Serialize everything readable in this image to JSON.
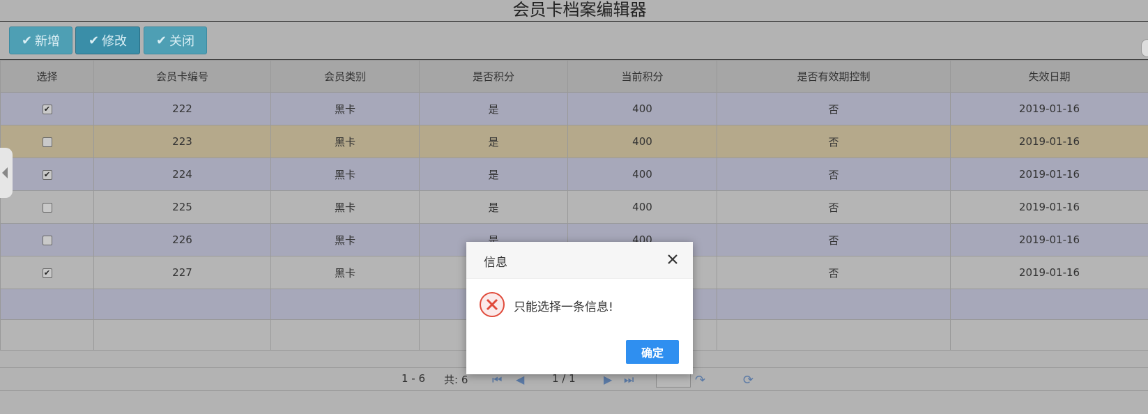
{
  "page": {
    "title": "会员卡档案编辑器"
  },
  "toolbar": {
    "add_label": "新增",
    "edit_label": "修改",
    "close_label": "关闭"
  },
  "table": {
    "columns": [
      "选择",
      "会员卡编号",
      "会员类别",
      "是否积分",
      "当前积分",
      "是否有效期控制",
      "失效日期"
    ],
    "rows": [
      {
        "checked": true,
        "card_no": "222",
        "type": "黑卡",
        "points_enabled": "是",
        "points": "400",
        "expiry_control": "否",
        "expiry_date": "2019-01-16"
      },
      {
        "checked": false,
        "card_no": "223",
        "type": "黑卡",
        "points_enabled": "是",
        "points": "400",
        "expiry_control": "否",
        "expiry_date": "2019-01-16"
      },
      {
        "checked": true,
        "card_no": "224",
        "type": "黑卡",
        "points_enabled": "是",
        "points": "400",
        "expiry_control": "否",
        "expiry_date": "2019-01-16"
      },
      {
        "checked": false,
        "card_no": "225",
        "type": "黑卡",
        "points_enabled": "是",
        "points": "400",
        "expiry_control": "否",
        "expiry_date": "2019-01-16"
      },
      {
        "checked": false,
        "card_no": "226",
        "type": "黑卡",
        "points_enabled": "是",
        "points": "400",
        "expiry_control": "否",
        "expiry_date": "2019-01-16"
      },
      {
        "checked": true,
        "card_no": "227",
        "type": "黑卡",
        "points_enabled": "",
        "points": "",
        "expiry_control": "否",
        "expiry_date": "2019-01-16"
      }
    ]
  },
  "pager": {
    "range": "1 - 6",
    "total": "共: 6",
    "page_info": "1 / 1"
  },
  "dialog": {
    "title": "信息",
    "message": "只能选择一条信息!",
    "ok_label": "确定"
  },
  "colors": {
    "button": "#4e9fb4",
    "row_alt": "#a7a8ba",
    "row_highlight": "#b5a98b",
    "ok_button": "#2f8ff0",
    "error": "#e04a3a"
  }
}
